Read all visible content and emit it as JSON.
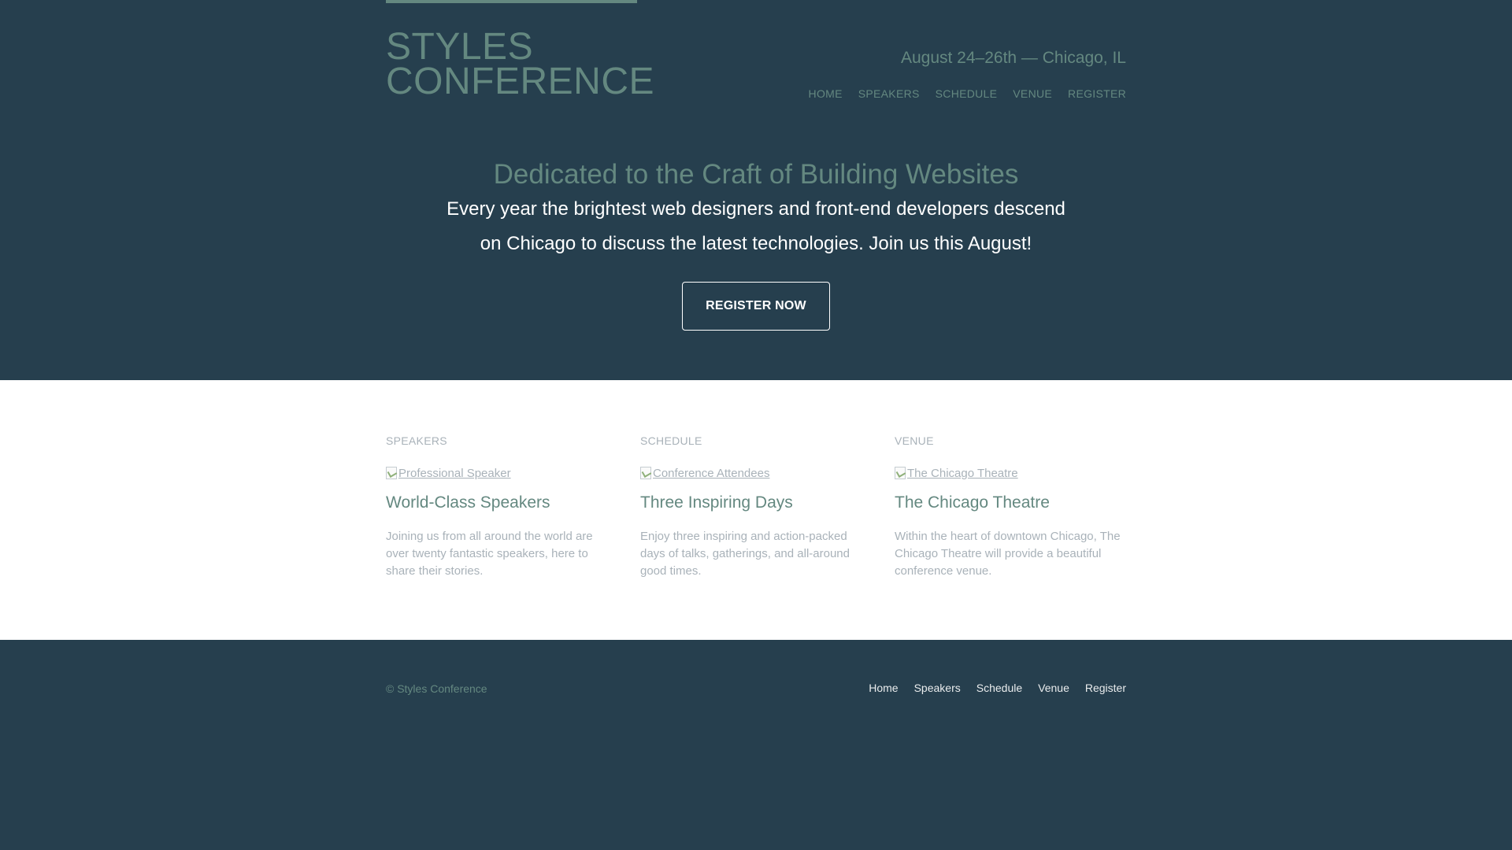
{
  "header": {
    "logo_line1": "Styles",
    "logo_line2": "Conference",
    "tagline": "August 24–26th — Chicago, IL",
    "nav": [
      "Home",
      "Speakers",
      "Schedule",
      "Venue",
      "Register"
    ]
  },
  "hero": {
    "heading": "Dedicated to the Craft of Building Websites",
    "text": "Every year the brightest web designers and front-end developers descend on Chicago to discuss the latest technologies. Join us this August!",
    "button": "Register Now"
  },
  "teasers": [
    {
      "section": "Speakers",
      "image_alt": "Professional Speaker",
      "title": "World-Class Speakers",
      "text": "Joining us from all around the world are over twenty fantastic speakers, here to share their stories."
    },
    {
      "section": "Schedule",
      "image_alt": "Conference Attendees",
      "title": "Three Inspiring Days",
      "text": "Enjoy three inspiring and action-packed days of talks, gatherings, and all-around good times."
    },
    {
      "section": "Venue",
      "image_alt": "The Chicago Theatre",
      "title": "The Chicago Theatre",
      "text": "Within the heart of downtown Chicago, The Chicago Theatre will provide a beautiful conference venue."
    }
  ],
  "footer": {
    "copyright": "© Styles Conference",
    "nav": [
      "Home",
      "Speakers",
      "Schedule",
      "Venue",
      "Register"
    ]
  },
  "colors": {
    "background": "#263f4e",
    "accent": "#648880",
    "muted_text": "#a9b2b9",
    "white": "#ffffff"
  }
}
